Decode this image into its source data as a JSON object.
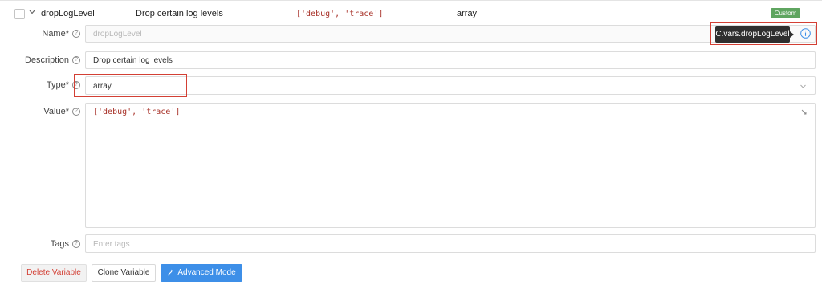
{
  "header": {
    "name": "dropLogLevel",
    "description": "Drop certain log levels",
    "value": "['debug', 'trace']",
    "type": "array",
    "badge": "Custom"
  },
  "form": {
    "name_label": "Name*",
    "name_placeholder": "dropLogLevel",
    "tooltip": "C.vars.dropLogLevel",
    "description_label": "Description",
    "description_value": "Drop certain log levels",
    "type_label": "Type*",
    "type_value": "array",
    "value_label": "Value*",
    "value_text": "['debug', 'trace']",
    "tags_label": "Tags",
    "tags_placeholder": "Enter tags"
  },
  "actions": {
    "delete_label": "Delete Variable",
    "clone_label": "Clone Variable",
    "advanced_label": "Advanced Mode"
  },
  "icons": [
    "chevron-down-icon",
    "help-icon",
    "info-icon",
    "expand-icon",
    "magic-wand-icon"
  ],
  "colors": {
    "badge_green": "#5fa560",
    "primary_blue": "#3d8fe8",
    "delete_red": "#d33f34",
    "highlight_red": "#d33f34",
    "tooltip_bg": "#2f2f2f"
  }
}
